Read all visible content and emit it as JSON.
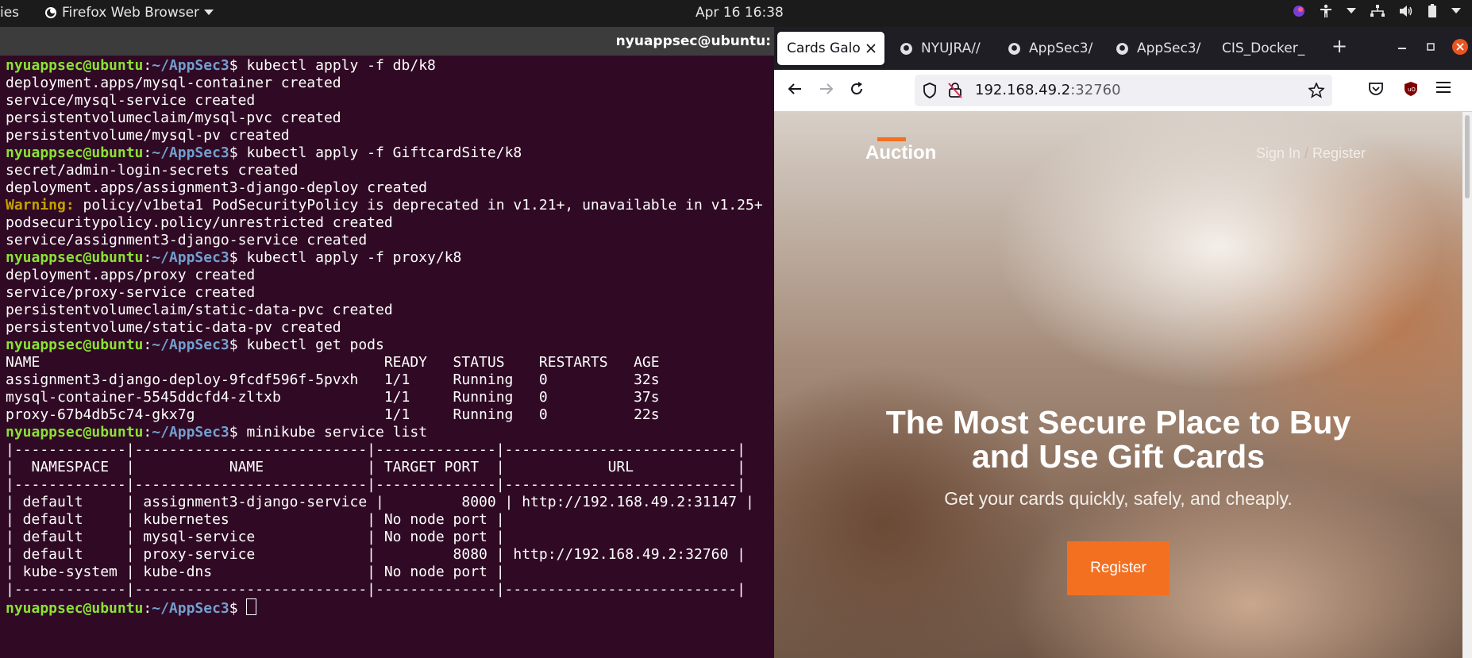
{
  "topbar": {
    "activities_label": "ies",
    "app_label": "Firefox Web Browser",
    "clock": "Apr 16  16:38"
  },
  "terminal": {
    "window_title": "nyuappsec@ubuntu:",
    "prompt_user": "nyuappsec@ubuntu",
    "prompt_path": "~/AppSec3",
    "cmd1": "kubectl apply -f db/k8",
    "out1": [
      "deployment.apps/mysql-container created",
      "service/mysql-service created",
      "persistentvolumeclaim/mysql-pvc created",
      "persistentvolume/mysql-pv created"
    ],
    "cmd2": "kubectl apply -f GiftcardSite/k8",
    "out2a": [
      "secret/admin-login-secrets created",
      "deployment.apps/assignment3-django-deploy created"
    ],
    "warning_label": "Warning:",
    "warning_text": " policy/v1beta1 PodSecurityPolicy is deprecated in v1.21+, unavailable in v1.25+",
    "out2b": [
      "podsecuritypolicy.policy/unrestricted created",
      "service/assignment3-django-service created"
    ],
    "cmd3": "kubectl apply -f proxy/k8",
    "out3": [
      "deployment.apps/proxy created",
      "service/proxy-service created",
      "persistentvolumeclaim/static-data-pvc created",
      "persistentvolume/static-data-pv created"
    ],
    "cmd4": "kubectl get pods",
    "pods_header": "NAME                                        READY   STATUS    RESTARTS   AGE",
    "pods": [
      "assignment3-django-deploy-9fcdf596f-5pvxh   1/1     Running   0          32s",
      "mysql-container-5545ddcfd4-zltxb            1/1     Running   0          37s",
      "proxy-67b4db5c74-gkx7g                      1/1     Running   0          22s"
    ],
    "cmd5": "minikube service list",
    "svc_table": [
      "|-------------|---------------------------|--------------|---------------------------|",
      "|  NAMESPACE  |           NAME            | TARGET PORT  |            URL            |",
      "|-------------|---------------------------|--------------|---------------------------|",
      "| default     | assignment3-django-service |         8000 | http://192.168.49.2:31147 |",
      "| default     | kubernetes                | No node port |",
      "| default     | mysql-service             | No node port |",
      "| default     | proxy-service             |         8080 | http://192.168.49.2:32760 |",
      "| kube-system | kube-dns                  | No node port |",
      "|-------------|---------------------------|--------------|---------------------------|"
    ]
  },
  "browser": {
    "tabs": [
      {
        "label": "Cards Galo",
        "active": true
      },
      {
        "label": "NYUJRA//",
        "active": false
      },
      {
        "label": "AppSec3/",
        "active": false
      },
      {
        "label": "AppSec3/",
        "active": false
      },
      {
        "label": "CIS_Docker_",
        "active": false
      }
    ],
    "new_tab": "+",
    "url_host": "192.168.49.2",
    "url_port": ":32760",
    "page": {
      "logo": "Auction",
      "sign_in": "Sign In",
      "separator": "/",
      "register_link": "Register",
      "headline_1": "The Most Secure Place to Buy",
      "headline_2": "and Use Gift Cards",
      "subheadline": "Get your cards quickly, safely, and cheaply.",
      "cta": "Register",
      "accent_color": "#f37021"
    }
  }
}
